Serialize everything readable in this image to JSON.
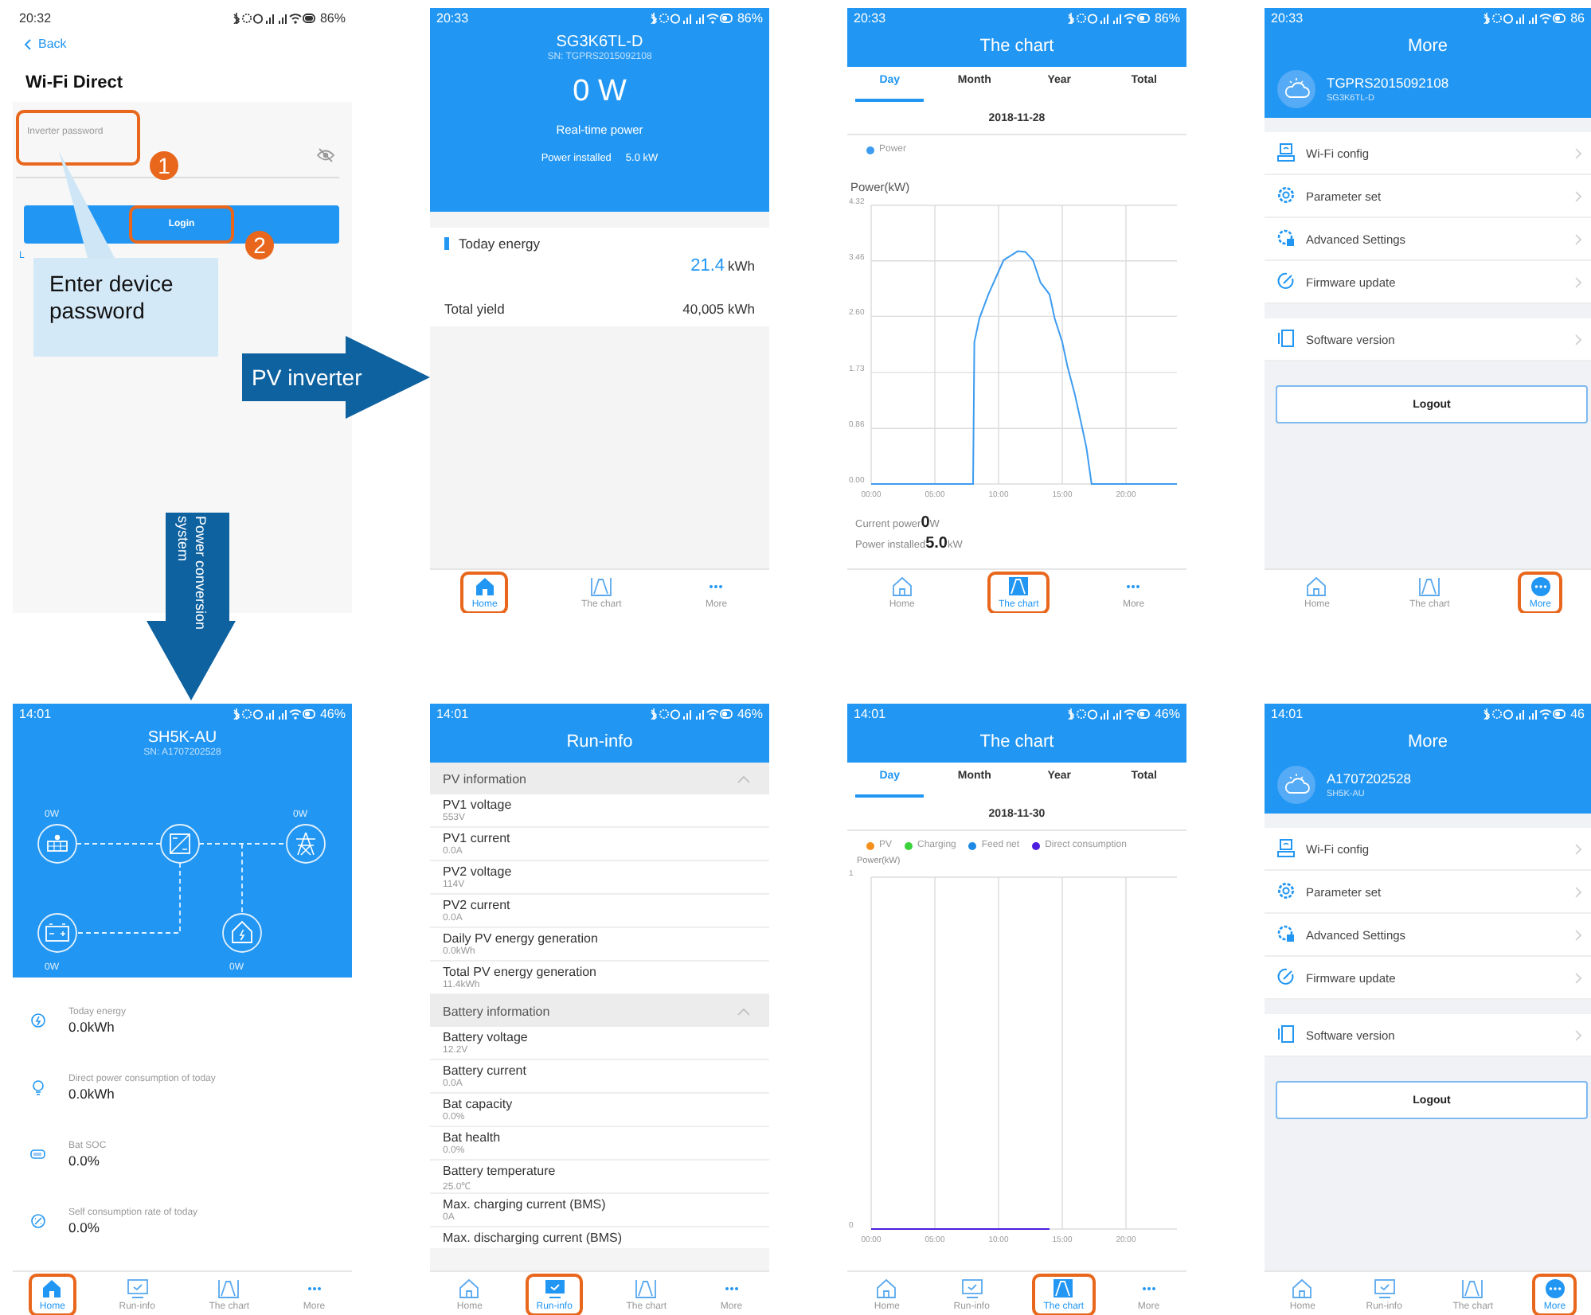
{
  "screens": [
    {
      "kind": "login",
      "status_bar": {
        "time": "20:32",
        "battery": "86%"
      },
      "back": "Back",
      "title": "Wi-Fi Direct",
      "password_field": {
        "placeholder": "Inverter password",
        "highlighted": true
      },
      "login_button": {
        "label": "Login",
        "highlighted": true
      },
      "link": "L"
    },
    {
      "kind": "inverter_home",
      "status_bar": {
        "time": "20:33",
        "battery": "86%"
      },
      "device": "SG3K6TL-D",
      "serial": "SN: TGPRS2015092108",
      "power": "0 W",
      "power_label": "Real-time power",
      "installed_label": "Power installed",
      "installed_value": "5.0 kW",
      "today_label": "Today energy",
      "today_value": "21.4",
      "today_unit": "kWh",
      "total_label": "Total yield",
      "total_value": "40,005 kWh",
      "tabs": [
        {
          "label": "Home",
          "kind": "home",
          "selected": true,
          "highlighted": true
        },
        {
          "label": "The chart",
          "kind": "chart",
          "selected": false,
          "highlighted": false
        },
        {
          "label": "More",
          "kind": "more",
          "selected": false,
          "highlighted": false
        }
      ]
    },
    {
      "kind": "chart",
      "status_bar": {
        "time": "20:33",
        "battery": "86%"
      },
      "title": "The chart",
      "period_tabs": [
        {
          "label": "Day",
          "selected": true
        },
        {
          "label": "Month",
          "selected": false
        },
        {
          "label": "Year",
          "selected": false
        },
        {
          "label": "Total",
          "selected": false
        }
      ],
      "date": "2018-11-28",
      "chart_data": {
        "type": "line",
        "ylabel": "Power(kW)",
        "grid": true,
        "xlim": [
          0,
          24
        ],
        "ylim": [
          0,
          4.32
        ],
        "x": [
          0,
          8.0,
          8.1,
          8.5,
          9.2,
          10.4,
          11.5,
          12.1,
          12.7,
          13.3,
          14.0,
          14.4,
          15.0,
          15.4,
          16.0,
          16.5,
          16.9,
          17.3,
          24
        ],
        "series": [
          {
            "name": "Power",
            "color": "#3d9cf0",
            "values": [
              0,
              0,
              2.2,
              2.57,
              2.94,
              3.47,
              3.61,
              3.6,
              3.47,
              3.12,
              2.94,
              2.57,
              2.2,
              1.83,
              1.38,
              0.93,
              0.56,
              0,
              0
            ]
          }
        ],
        "xticks": [
          {
            "value": 0,
            "label": "00:00"
          },
          {
            "value": 5,
            "label": "05:00"
          },
          {
            "value": 10,
            "label": "10:00"
          },
          {
            "value": 15,
            "label": "15:00"
          },
          {
            "value": 20,
            "label": "20:00"
          }
        ],
        "yticks": [
          {
            "value": 0,
            "label": "0.00"
          },
          {
            "value": 0.86,
            "label": "0.86"
          },
          {
            "value": 1.73,
            "label": "1.73"
          },
          {
            "value": 2.6,
            "label": "2.60"
          },
          {
            "value": 3.46,
            "label": "3.46"
          },
          {
            "value": 4.32,
            "label": "4.32"
          }
        ]
      },
      "footer": [
        {
          "label": "Current power",
          "value": "0",
          "unit": "W"
        },
        {
          "label": "Power installed",
          "value": "5.0",
          "unit": "kW"
        }
      ],
      "tabs": [
        {
          "label": "Home",
          "kind": "home",
          "selected": false,
          "highlighted": false
        },
        {
          "label": "The chart",
          "kind": "chart",
          "selected": true,
          "highlighted": true
        },
        {
          "label": "More",
          "kind": "more",
          "selected": false,
          "highlighted": false
        }
      ]
    },
    {
      "kind": "more",
      "status_bar": {
        "time": "20:33",
        "battery": "86"
      },
      "title": "More",
      "account": "TGPRS2015092108",
      "model": "SG3K6TL-D",
      "menu_groups": [
        {
          "items": [
            {
              "label": "Wi-Fi config",
              "kind": "wifi_config"
            },
            {
              "label": "Parameter set",
              "kind": "gear"
            },
            {
              "label": "Advanced Settings",
              "kind": "advanced"
            },
            {
              "label": "Firmware update",
              "kind": "update"
            }
          ]
        },
        {
          "items": [
            {
              "label": "Software version",
              "kind": "version"
            }
          ]
        }
      ],
      "logout": "Logout",
      "tabs": [
        {
          "label": "Home",
          "kind": "home",
          "selected": false,
          "highlighted": false
        },
        {
          "label": "The chart",
          "kind": "chart",
          "selected": false,
          "highlighted": false
        },
        {
          "label": "More",
          "kind": "more",
          "selected": true,
          "highlighted": true
        }
      ]
    },
    {
      "kind": "pcs_home",
      "status_bar": {
        "time": "14:01",
        "battery": "46%"
      },
      "device": "SH5K-AU",
      "serial": "SN: A1707202528",
      "flow": [
        {
          "kind": "solar",
          "reading": "0W"
        },
        {
          "kind": "inverter"
        },
        {
          "kind": "grid",
          "reading": "0W"
        },
        {
          "kind": "battery",
          "reading": "0W"
        },
        {
          "kind": "house",
          "reading": "0W"
        }
      ],
      "stats": [
        {
          "kind": "energy",
          "label": "Today energy",
          "value": "0.0kWh"
        },
        {
          "kind": "bulb",
          "label": "Direct power consumption of today",
          "value": "0.0kWh"
        },
        {
          "kind": "battery",
          "label": "Bat SOC",
          "value": "0.0%"
        },
        {
          "kind": "rate",
          "label": "Self consumption rate of today",
          "value": "0.0%"
        }
      ],
      "tabs": [
        {
          "label": "Home",
          "kind": "home",
          "selected": true,
          "highlighted": true
        },
        {
          "label": "Run-info",
          "kind": "run",
          "selected": false,
          "highlighted": false
        },
        {
          "label": "The chart",
          "kind": "chart",
          "selected": false,
          "highlighted": false
        },
        {
          "label": "More",
          "kind": "more",
          "selected": false,
          "highlighted": false
        }
      ]
    },
    {
      "kind": "run_info",
      "status_bar": {
        "time": "14:01",
        "battery": "46%"
      },
      "title": "Run-info",
      "sections": [
        {
          "title": "PV information",
          "expanded": true,
          "items": [
            {
              "label": "PV1 voltage",
              "value": "553V"
            },
            {
              "label": "PV1 current",
              "value": "0.0A"
            },
            {
              "label": "PV2 voltage",
              "value": "114V"
            },
            {
              "label": "PV2 current",
              "value": "0.0A"
            },
            {
              "label": "Daily PV energy generation",
              "value": "0.0kWh"
            },
            {
              "label": "Total PV energy generation",
              "value": "11.4kWh"
            }
          ]
        },
        {
          "title": "Battery information",
          "expanded": true,
          "items": [
            {
              "label": "Battery voltage",
              "value": "12.2V"
            },
            {
              "label": "Battery current",
              "value": "0.0A"
            },
            {
              "label": "Bat capacity",
              "value": "0.0%"
            },
            {
              "label": "Bat health",
              "value": "0.0%"
            },
            {
              "label": "Battery temperature",
              "value": "25.0℃"
            },
            {
              "label": "Max. charging current (BMS)",
              "value": "0A"
            },
            {
              "label": "Max. discharging current (BMS)"
            }
          ]
        }
      ],
      "tabs": [
        {
          "label": "Home",
          "kind": "home",
          "selected": false,
          "highlighted": false
        },
        {
          "label": "Run-info",
          "kind": "run",
          "selected": true,
          "highlighted": true
        },
        {
          "label": "The chart",
          "kind": "chart",
          "selected": false,
          "highlighted": false
        },
        {
          "label": "More",
          "kind": "more",
          "selected": false,
          "highlighted": false
        }
      ]
    },
    {
      "kind": "chart",
      "status_bar": {
        "time": "14:01",
        "battery": "46%"
      },
      "title": "The chart",
      "period_tabs": [
        {
          "label": "Day",
          "selected": true
        },
        {
          "label": "Month",
          "selected": false
        },
        {
          "label": "Year",
          "selected": false
        },
        {
          "label": "Total",
          "selected": false
        }
      ],
      "date": "2018-11-30",
      "chart_data": {
        "type": "line",
        "ylabel": "Power(kW)",
        "grid": true,
        "xlim": [
          0,
          24
        ],
        "ylim": [
          0,
          1
        ],
        "x": [
          0,
          14
        ],
        "series": [
          {
            "name": "PV",
            "color": "#f5901e",
            "values": [
              null,
              null
            ]
          },
          {
            "name": "Charging",
            "color": "#3cd23c",
            "values": [
              null,
              null
            ]
          },
          {
            "name": "Feed net",
            "color": "#1e88e5",
            "values": [
              null,
              null
            ]
          },
          {
            "name": "Direct consumption",
            "color": "#4b1ee0",
            "values": [
              0,
              0
            ]
          }
        ],
        "xticks": [
          {
            "value": 0,
            "label": "00:00"
          },
          {
            "value": 5,
            "label": "05:00"
          },
          {
            "value": 10,
            "label": "10:00"
          },
          {
            "value": 15,
            "label": "15:00"
          },
          {
            "value": 20,
            "label": "20:00"
          }
        ],
        "yticks": [
          0,
          1
        ]
      },
      "tabs": [
        {
          "label": "Home",
          "kind": "home",
          "selected": false,
          "highlighted": false
        },
        {
          "label": "Run-info",
          "kind": "run",
          "selected": false,
          "highlighted": false
        },
        {
          "label": "The chart",
          "kind": "chart",
          "selected": true,
          "highlighted": true
        },
        {
          "label": "More",
          "kind": "more",
          "selected": false,
          "highlighted": false
        }
      ]
    },
    {
      "kind": "more",
      "status_bar": {
        "time": "14:01",
        "battery": "46"
      },
      "title": "More",
      "account": "A1707202528",
      "model": "SH5K-AU",
      "menu_groups": [
        {
          "items": [
            {
              "label": "Wi-Fi config",
              "kind": "wifi_config"
            },
            {
              "label": "Parameter set",
              "kind": "gear"
            },
            {
              "label": "Advanced Settings",
              "kind": "advanced"
            },
            {
              "label": "Firmware update",
              "kind": "update"
            }
          ]
        },
        {
          "items": [
            {
              "label": "Software version",
              "kind": "version"
            }
          ]
        }
      ],
      "logout": "Logout",
      "tabs": [
        {
          "label": "Home",
          "kind": "home",
          "selected": false,
          "highlighted": false
        },
        {
          "label": "Run-info",
          "kind": "run",
          "selected": false,
          "highlighted": false
        },
        {
          "label": "The chart",
          "kind": "chart",
          "selected": false,
          "highlighted": false
        },
        {
          "label": "More",
          "kind": "more",
          "selected": true,
          "highlighted": true
        }
      ]
    }
  ],
  "annotations": {
    "steps": [
      {
        "number": "1"
      },
      {
        "number": "2"
      }
    ],
    "callout": "Enter device password",
    "arrows": [
      {
        "kind": "right",
        "label": "PV inverter"
      },
      {
        "kind": "down",
        "label": "Power conversion system"
      }
    ]
  }
}
